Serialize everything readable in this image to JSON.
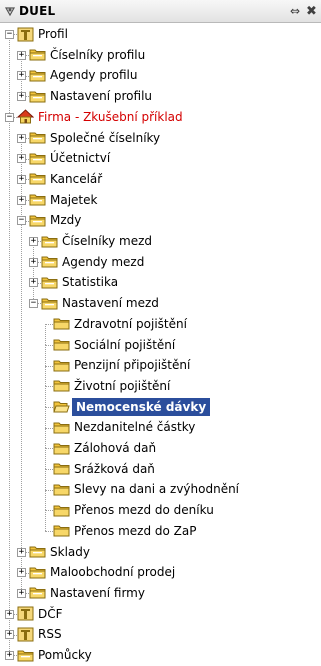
{
  "panel": {
    "title": "DUEL",
    "resize_glyph": "⇔",
    "close_glyph": "✖"
  },
  "tree": [
    {
      "label": "Profil",
      "icon": "module-icon",
      "expander": "−"
    },
    {
      "label": "Číselníky profilu",
      "icon": "folder-icon",
      "expander": "+"
    },
    {
      "label": "Agendy profilu",
      "icon": "folder-icon",
      "expander": "+"
    },
    {
      "label": "Nastavení profilu",
      "icon": "folder-icon",
      "expander": "+"
    },
    {
      "label": "Firma - Zkušební příklad",
      "icon": "home-icon",
      "expander": "−"
    },
    {
      "label": "Společné číselníky",
      "icon": "folder-icon",
      "expander": "+"
    },
    {
      "label": "Účetnictví",
      "icon": "folder-icon",
      "expander": "+"
    },
    {
      "label": "Kancelář",
      "icon": "folder-icon",
      "expander": "+"
    },
    {
      "label": "Majetek",
      "icon": "folder-icon",
      "expander": "+"
    },
    {
      "label": "Mzdy",
      "icon": "folder-icon",
      "expander": "−"
    },
    {
      "label": "Číselníky mezd",
      "icon": "folder-icon",
      "expander": "+"
    },
    {
      "label": "Agendy mezd",
      "icon": "folder-icon",
      "expander": "+"
    },
    {
      "label": "Statistika",
      "icon": "folder-icon",
      "expander": "+"
    },
    {
      "label": "Nastavení mezd",
      "icon": "folder-icon",
      "expander": "−"
    },
    {
      "label": "Zdravotní pojištění",
      "icon": "closed-folder-icon"
    },
    {
      "label": "Sociální pojištění",
      "icon": "closed-folder-icon"
    },
    {
      "label": "Penzijní připojištění",
      "icon": "closed-folder-icon"
    },
    {
      "label": "Životní pojištění",
      "icon": "closed-folder-icon"
    },
    {
      "label": "Nemocenské dávky",
      "icon": "open-folder-icon",
      "selected": true
    },
    {
      "label": "Nezdanitelné částky",
      "icon": "closed-folder-icon"
    },
    {
      "label": "Zálohová daň",
      "icon": "closed-folder-icon"
    },
    {
      "label": "Srážková daň",
      "icon": "closed-folder-icon"
    },
    {
      "label": "Slevy na dani a zvýhodnění",
      "icon": "closed-folder-icon"
    },
    {
      "label": "Přenos mezd do deníku",
      "icon": "closed-folder-icon"
    },
    {
      "label": "Přenos mezd do ZaP",
      "icon": "closed-folder-icon"
    },
    {
      "label": "Sklady",
      "icon": "folder-icon",
      "expander": "+"
    },
    {
      "label": "Maloobchodní prodej",
      "icon": "folder-icon",
      "expander": "+"
    },
    {
      "label": "Nastavení firmy",
      "icon": "folder-icon",
      "expander": "+"
    },
    {
      "label": "DČF",
      "icon": "module-icon",
      "expander": "+"
    },
    {
      "label": "RSS",
      "icon": "module-icon",
      "expander": "+"
    },
    {
      "label": "Pomůcky",
      "icon": "folder-icon",
      "expander": "+"
    }
  ],
  "colors": {
    "selection": "#2b4e9c",
    "highlight_text": "#d40000",
    "folder": "#f2c43c"
  }
}
